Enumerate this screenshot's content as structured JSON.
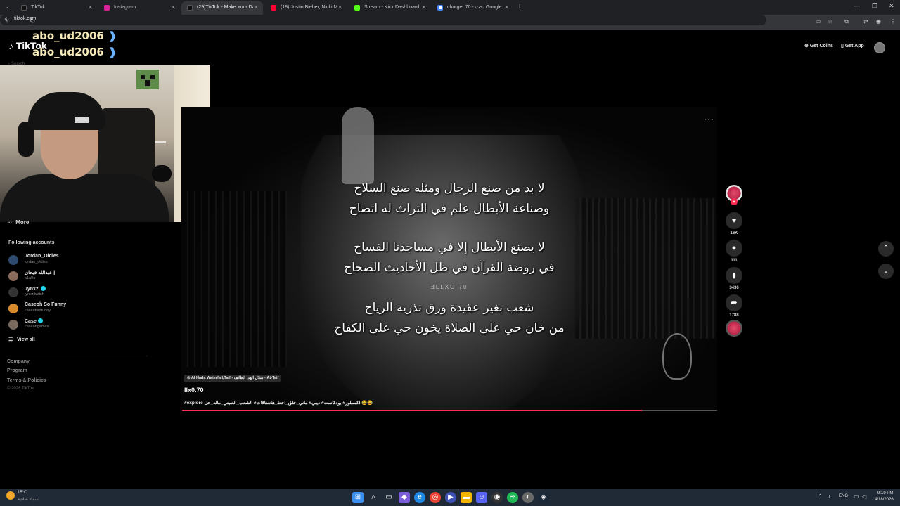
{
  "browser": {
    "tabs": [
      {
        "label": "TikTok",
        "color": "#111111",
        "active": false
      },
      {
        "label": "Instagram",
        "color": "#d6249f",
        "active": false
      },
      {
        "label": "(29)TikTok - Make Your Day",
        "color": "#111111",
        "active": true
      },
      {
        "label": "(18) Justin Bieber, Nicki Minaj -",
        "color": "#ff0033",
        "active": false
      },
      {
        "label": "Stream - Kick Dashboard",
        "color": "#53fc18",
        "active": false
      },
      {
        "label": "charger 70 - بحث Google",
        "color": "#4285f4",
        "active": false
      }
    ],
    "url": "tiktok.com"
  },
  "overlay": {
    "name1": "abo_ud2006",
    "name2": "abo_ud2006"
  },
  "tiktok": {
    "logo": "TikTok",
    "search_placeholder": "Search",
    "more_label": "More",
    "get_coins": "Get Coins",
    "get_app": "Get App",
    "following_title": "Following accounts",
    "accounts": [
      {
        "name": "Jordan_Oldies",
        "handle": "jordan_oldies",
        "verified": false,
        "color": "#2d4a6e"
      },
      {
        "name": "عبدالله فيحان |",
        "handle": "a1a9o",
        "verified": false,
        "color": "#8a6a5a"
      },
      {
        "name": "Jynxzi",
        "handle": "jynxzitwitch",
        "verified": true,
        "color": "#333333"
      },
      {
        "name": "Caseoh So Funny",
        "handle": "caseohsofunny",
        "verified": false,
        "color": "#d98b2b"
      },
      {
        "name": "Case",
        "handle": "caseohgames",
        "verified": true,
        "color": "#7a6a5e"
      }
    ],
    "view_all": "View all",
    "footer": [
      "Company",
      "Program",
      "Terms & Policies"
    ],
    "copyright": "© 2026 TikTok"
  },
  "video": {
    "verses": [
      "لا بد من صنع الرجال ومثله صنع السلاح",
      "وصناعة الأبطال علم في التراث له اتضاح",
      "لا يصنع الأبطال إلا في مساجدنا الفساح",
      "في روضة القرآن في ظل الأحاديث الصحاح",
      "شعب بغير عقيدة ورق تذريه الرياح",
      "من خان حي على الصلاة يخون حي على الكفاح"
    ],
    "watermark": "ƎLLXO 70",
    "location": "Al Hada Waterfall,Taif - شلال الهدا الطائف - At-Taif",
    "author": "llx0.70",
    "caption": "#explore اكسبلور# بودكاست# ديني# ماني_خلق_احط_هاشتاقات# الشعب_الصيني_ماله_حل 😂😂",
    "progress": 0.86,
    "likes": "16K",
    "comments": "111",
    "saves": "3436",
    "shares": "1788"
  },
  "taskbar": {
    "temp": "15°C",
    "weather": "سماء صافية",
    "lang": "ENG",
    "time": "9:19 PM",
    "date": "4/18/2026"
  }
}
